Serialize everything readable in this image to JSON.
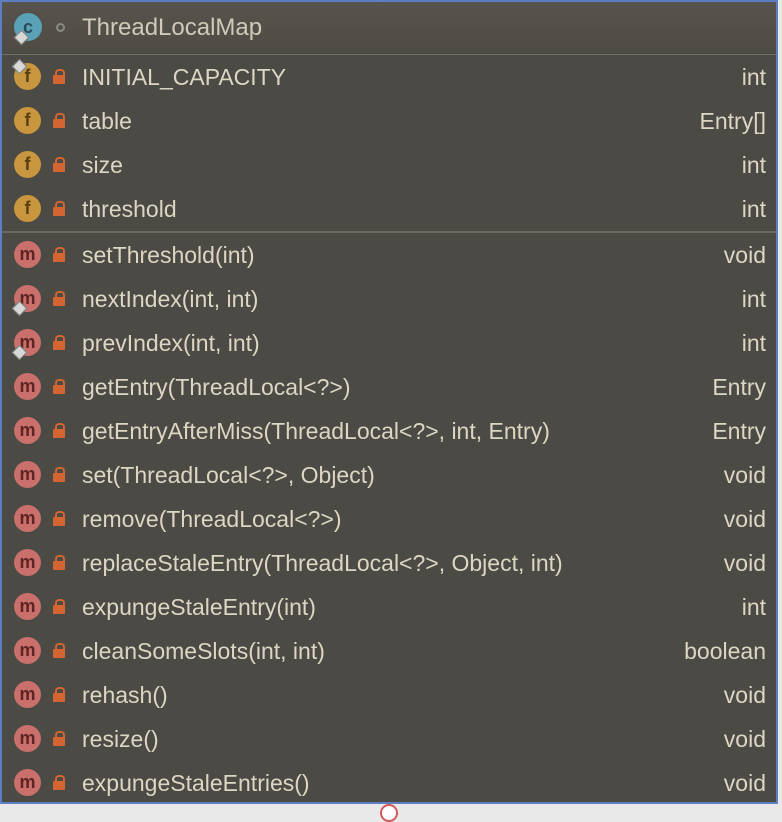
{
  "header": {
    "title": "ThreadLocalMap",
    "class_icon_letter": "c"
  },
  "fields": [
    {
      "name": "INITIAL_CAPACITY",
      "type": "int",
      "badge": true
    },
    {
      "name": "table",
      "type": "Entry[]",
      "badge": false
    },
    {
      "name": "size",
      "type": "int",
      "badge": false
    },
    {
      "name": "threshold",
      "type": "int",
      "badge": false
    }
  ],
  "methods": [
    {
      "name": "setThreshold(int)",
      "type": "void",
      "badge": false
    },
    {
      "name": "nextIndex(int, int)",
      "type": "int",
      "badge": true
    },
    {
      "name": "prevIndex(int, int)",
      "type": "int",
      "badge": true
    },
    {
      "name": "getEntry(ThreadLocal<?>)",
      "type": "Entry",
      "badge": false
    },
    {
      "name": "getEntryAfterMiss(ThreadLocal<?>, int, Entry)",
      "type": "Entry",
      "badge": false
    },
    {
      "name": "set(ThreadLocal<?>, Object)",
      "type": "void",
      "badge": false
    },
    {
      "name": "remove(ThreadLocal<?>)",
      "type": "void",
      "badge": false
    },
    {
      "name": "replaceStaleEntry(ThreadLocal<?>, Object, int)",
      "type": "void",
      "badge": false
    },
    {
      "name": "expungeStaleEntry(int)",
      "type": "int",
      "badge": false
    },
    {
      "name": "cleanSomeSlots(int, int)",
      "type": "boolean",
      "badge": false
    },
    {
      "name": "rehash()",
      "type": "void",
      "badge": false
    },
    {
      "name": "resize()",
      "type": "void",
      "badge": false
    },
    {
      "name": "expungeStaleEntries()",
      "type": "void",
      "badge": false
    }
  ],
  "icons": {
    "field_letter": "f",
    "method_letter": "m",
    "lock": "lock-icon"
  },
  "colors": {
    "panel": "#4c4a44",
    "field_icon": "#c8963e",
    "method_icon": "#c9706c",
    "class_icon": "#5aa2b8",
    "lock": "#d26532",
    "border": "#5c7fc4"
  }
}
